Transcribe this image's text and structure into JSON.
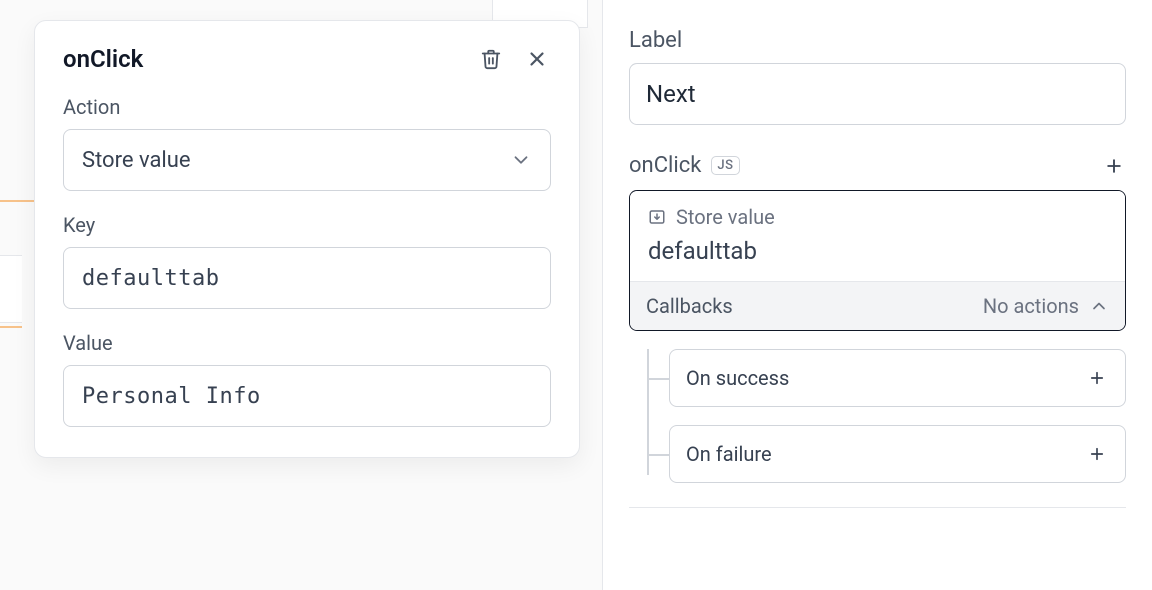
{
  "popover": {
    "title": "onClick",
    "action_label": "Action",
    "action_value": "Store value",
    "key_label": "Key",
    "key_value": "defaulttab",
    "value_label": "Value",
    "value_value": "Personal Info"
  },
  "inspector": {
    "label_field_label": "Label",
    "label_field_value": "Next",
    "onclick_label": "onClick",
    "js_badge": "JS",
    "action_card": {
      "title": "Store value",
      "value": "defaulttab"
    },
    "callbacks": {
      "label": "Callbacks",
      "status": "No actions",
      "on_success": "On success",
      "on_failure": "On failure"
    }
  }
}
